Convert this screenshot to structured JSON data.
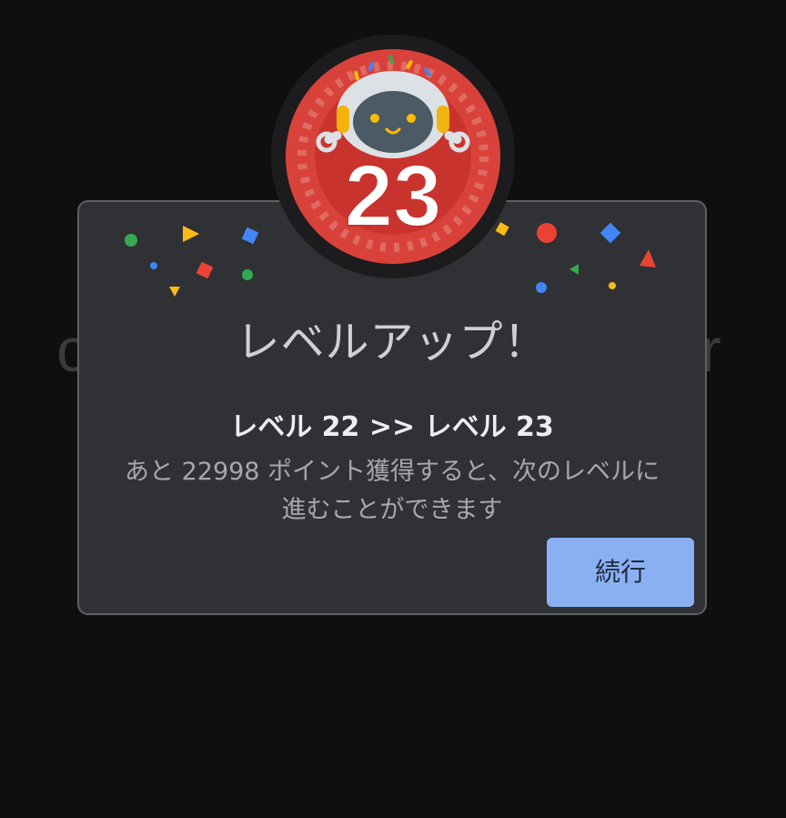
{
  "background": {
    "left_fragment": "c",
    "right_fragment": "r"
  },
  "badge": {
    "level_number": "23",
    "color": "#d9423a",
    "icon": "robot-mascot-icon"
  },
  "dialog": {
    "title": "レベルアップ！",
    "level_change": "レベル 22 >> レベル 23",
    "description": "あと 22998 ポイント獲得すると、次のレベルに進むことができます",
    "continue_label": "続行"
  },
  "colors": {
    "dialog_bg": "#303134",
    "button_bg": "#8ab0f3",
    "page_bg": "#0f0f11"
  }
}
